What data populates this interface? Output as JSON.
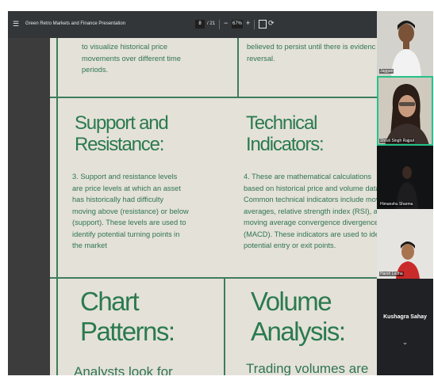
{
  "toolbar": {
    "menu_icon": "hamburger-menu-icon",
    "title": "Green Retro Markets and Finance Presentation",
    "page_current": "8",
    "page_total": "/ 21",
    "zoom_minus": "−",
    "zoom": "67%",
    "zoom_plus": "+",
    "fit_icon": "fit-page-icon",
    "rotate_icon": "rotate-icon"
  },
  "slide_top": {
    "left_text": [
      "to visualize historical price",
      "movements over different time",
      "periods."
    ],
    "right_text": [
      "believed to persist until there is evidenc",
      "reversal."
    ]
  },
  "slide_mid": {
    "left_heading": [
      "Support and",
      "Resistance:"
    ],
    "left_body": [
      "3. Support and resistance levels",
      "are price levels at which an asset",
      "has historically had difficulty",
      "moving above (resistance) or below",
      "(support). These levels are used to",
      "identify potential turning points in",
      "the market"
    ],
    "right_heading": [
      "Technical",
      "Indicators:"
    ],
    "right_body": [
      "4. These are mathematical calculations",
      "based on historical price and volume data",
      "Common technical indicators include mov",
      "averages, relative strength index (RSI), a",
      "moving average convergence divergence",
      "(MACD). These indicators are used to iden",
      "potential entry or exit points."
    ]
  },
  "slide_bottom": {
    "left_heading": [
      "Chart",
      "Patterns:"
    ],
    "left_sub": "Analysts look for",
    "right_heading": [
      "Volume",
      "Analysis:"
    ],
    "right_sub": "Trading volumes are"
  },
  "participants": [
    {
      "name": "Jaggan",
      "active": false
    },
    {
      "name": "Shruti Singh Rajput",
      "active": true
    },
    {
      "name": "Himanshu Sharma",
      "active": false
    },
    {
      "name": "Harsh Lodha",
      "active": false
    }
  ],
  "speaker_name": "Kushagra Sahay",
  "expand_icon": "chevron-down-icon",
  "colors": {
    "accent_green": "#2b7a4e",
    "paper": "#e4e1d9",
    "active_border": "#24c38a"
  }
}
